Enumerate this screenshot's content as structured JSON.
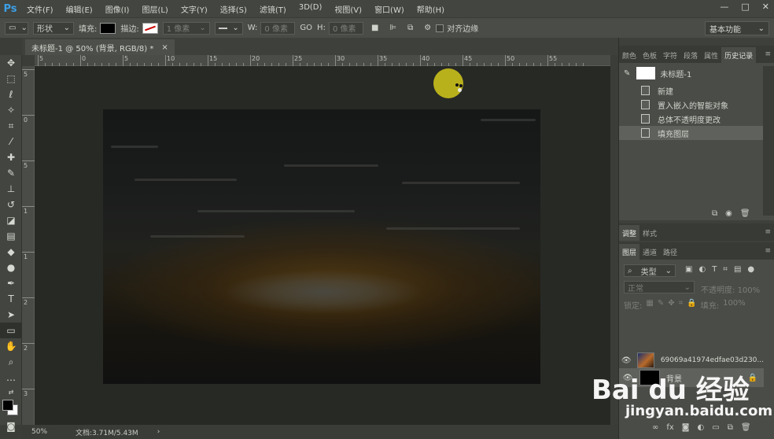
{
  "app": {
    "logo": "Ps"
  },
  "menu": [
    "文件(F)",
    "编辑(E)",
    "图像(I)",
    "图层(L)",
    "文字(Y)",
    "选择(S)",
    "滤镜(T)",
    "3D(D)",
    "视图(V)",
    "窗口(W)",
    "帮助(H)"
  ],
  "window_controls": {
    "minimize": "—",
    "maximize": "□",
    "close": "✕"
  },
  "options": {
    "shape_mode": "形状",
    "fill_label": "填充:",
    "stroke_label": "描边:",
    "stroke_width": "1 像素",
    "w_label": "W:",
    "w_value": "0 像素",
    "link": "GO",
    "h_label": "H:",
    "h_value": "0 像素",
    "align_edges": "对齐边缘",
    "workspace": "基本功能"
  },
  "document": {
    "tab_title": "未标题-1 @ 50% (背景, RGB/8) *",
    "tab_close": "×",
    "zoom": "50%",
    "doc_info": "文档:3.71M/5.43M"
  },
  "ruler_h": [
    "5",
    "0",
    "5",
    "10",
    "15",
    "20",
    "25",
    "30",
    "35",
    "40",
    "45",
    "50",
    "55"
  ],
  "ruler_v": [
    "5",
    "0",
    "5",
    "1",
    "1",
    "2",
    "2",
    "3"
  ],
  "panels_top": {
    "tabs": [
      "颜色",
      "色板",
      "字符",
      "段落",
      "属性",
      "历史记录"
    ],
    "active": "历史记录",
    "snapshot": "未标题-1",
    "history": [
      "新建",
      "置入嵌入的智能对象",
      "总体不透明度更改",
      "填充图层"
    ]
  },
  "panels_mid": {
    "tabs": [
      "调整",
      "样式"
    ]
  },
  "layers_panel": {
    "tabs": [
      "图层",
      "通道",
      "路径"
    ],
    "filter": "类型",
    "blend_mode": "正常",
    "opacity_label": "不透明度:",
    "opacity_value": "100%",
    "lock_label": "锁定:",
    "fill_label": "填充:",
    "fill_value": "100%",
    "layers": [
      {
        "name": "69069a41974edfae03d230...",
        "type": "smart"
      },
      {
        "name": "背景",
        "type": "background"
      }
    ]
  },
  "watermark": {
    "brand": "Bai du 经验",
    "url": "jingyan.baidu.com"
  },
  "colors": {
    "accent": "#3ba0e6",
    "cursor": "#c6bd1b",
    "canvas_bg": "#272925"
  }
}
